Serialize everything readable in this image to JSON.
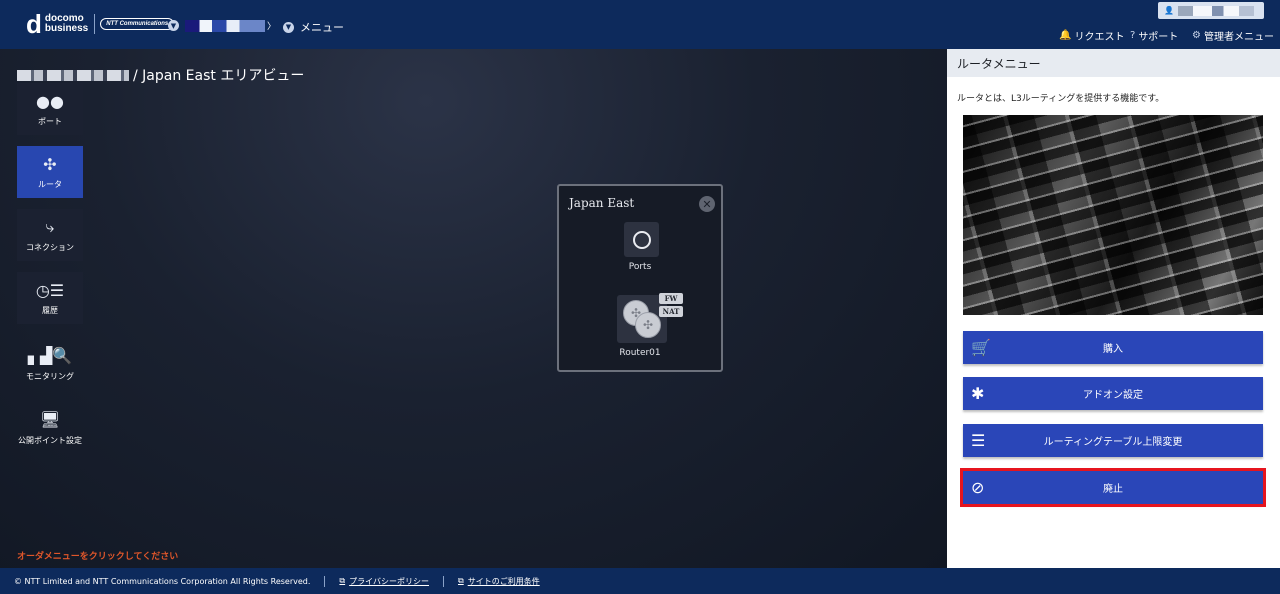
{
  "header": {
    "brand_docomo": "docomo",
    "brand_business": "business",
    "brand_ntt": "NTT Communications",
    "crumb_icon": "chevron-right",
    "menu_label": "メニュー",
    "nav": {
      "request": "リクエスト",
      "support": "サポート",
      "admin_menu": "管理者メニュー"
    }
  },
  "page": {
    "title_suffix": "/ Japan East エリアビュー"
  },
  "sidebar": {
    "items": [
      {
        "label": "ポート",
        "icon": "port-icon"
      },
      {
        "label": "ルータ",
        "icon": "router-icon"
      },
      {
        "label": "コネクション",
        "icon": "connection-icon"
      },
      {
        "label": "履歴",
        "icon": "history-icon"
      },
      {
        "label": "モニタリング",
        "icon": "monitoring-icon"
      },
      {
        "label": "公開ポイント設定",
        "icon": "public-point-icon"
      }
    ]
  },
  "hint": "オーダメニューをクリックしてください",
  "popup": {
    "title": "Japan East",
    "ports_label": "Ports",
    "router_label": "Router01",
    "badge_fw": "FW",
    "badge_nat": "NAT"
  },
  "panel": {
    "title": "ルータメニュー",
    "description": "ルータとは、L3ルーティングを提供する機能です。",
    "buttons": {
      "purchase": "購入",
      "addon": "アドオン設定",
      "routing_table": "ルーティングテーブル上限変更",
      "abolish": "廃止"
    }
  },
  "footer": {
    "copyright": "© NTT Limited and NTT Communications Corporation All Rights Reserved.",
    "privacy": "プライバシーポリシー",
    "terms": "サイトのご利用条件"
  },
  "colors": {
    "header_bg": "#0d2a5c",
    "button_bg": "#2a46b8",
    "highlight": "#e6141e",
    "hint_text": "#e0562a"
  }
}
